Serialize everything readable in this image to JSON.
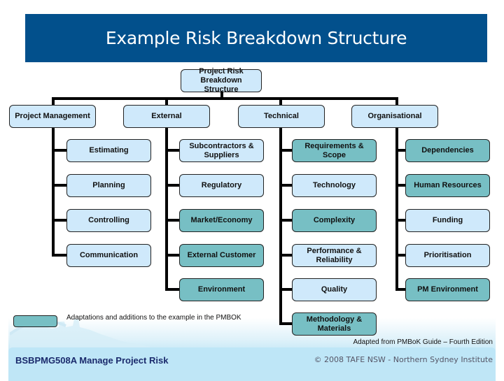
{
  "title": "Example Risk Breakdown Structure",
  "root": "Project Risk Breakdown Structure",
  "categories": [
    {
      "label": "Project Management",
      "children": [
        {
          "label": "Estimating",
          "adapted": false
        },
        {
          "label": "Planning",
          "adapted": false
        },
        {
          "label": "Controlling",
          "adapted": false
        },
        {
          "label": "Communication",
          "adapted": false
        }
      ]
    },
    {
      "label": "External",
      "children": [
        {
          "label": "Subcontractors & Suppliers",
          "adapted": false
        },
        {
          "label": "Regulatory",
          "adapted": false
        },
        {
          "label": "Market/Economy",
          "adapted": true
        },
        {
          "label": "External Customer",
          "adapted": true
        },
        {
          "label": "Environment",
          "adapted": true
        }
      ]
    },
    {
      "label": "Technical",
      "children": [
        {
          "label": "Requirements & Scope",
          "adapted": true
        },
        {
          "label": "Technology",
          "adapted": false
        },
        {
          "label": "Complexity",
          "adapted": true
        },
        {
          "label": "Performance & Reliability",
          "adapted": false
        },
        {
          "label": "Quality",
          "adapted": false
        },
        {
          "label": "Methodology & Materials",
          "adapted": true
        }
      ]
    },
    {
      "label": "Organisational",
      "children": [
        {
          "label": "Dependencies",
          "adapted": true
        },
        {
          "label": "Human Resources",
          "adapted": true
        },
        {
          "label": "Funding",
          "adapted": false
        },
        {
          "label": "Prioritisation",
          "adapted": false
        },
        {
          "label": "PM Environment",
          "adapted": true
        }
      ]
    }
  ],
  "legend": {
    "adapted_label": "Adaptations and additions to the example in the PMBOK"
  },
  "credit": "Adapted from PMBoK Guide – Fourth Edition",
  "footer": {
    "course": "BSBPMG508A Manage Project Risk",
    "copyright": "© 2008 TAFE NSW - Northern Sydney Institute"
  },
  "colors": {
    "banner": "#02508c",
    "standard_box": "#cfe9fb",
    "adapted_box": "#77bfc4",
    "footer_band": "#bee6f7"
  }
}
